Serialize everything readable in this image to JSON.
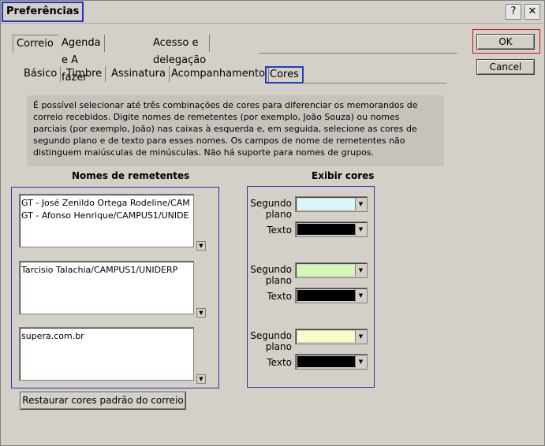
{
  "window": {
    "title": "Preferências",
    "help_label": "?",
    "close_label": "✕"
  },
  "tabs_top": [
    {
      "label": "Correio"
    },
    {
      "label": "Agenda e A fazer"
    },
    {
      "label": "Acesso e delegação"
    }
  ],
  "tabs_sub": [
    {
      "label": "Básico"
    },
    {
      "label": "Timbre"
    },
    {
      "label": "Assinatura"
    },
    {
      "label": "Acompanhamento"
    },
    {
      "label": "Cores"
    }
  ],
  "description": [
    "É possível selecionar até três combinações de cores para diferenciar os memorandos de",
    "correio recebidos.  Digite nomes de remetentes (por exemplo, João Souza) ou nomes",
    "parciais (por exemplo, João) nas caixas à esquerda e, em seguida, selecione as cores de",
    "segundo plano e de texto para esses nomes.  Os campos de nome de remetentes não",
    "distinguem maiúsculas de minúsculas.  Não há suporte para nomes de grupos."
  ],
  "senders": {
    "header": "Nomes de remetentes",
    "lists": [
      [
        "GT - José Zenildo Ortega Rodeline/CAM",
        "GT - Afonso Henrique/CAMPUS1/UNIDE"
      ],
      [
        "Tarcisio Talachia/CAMPUS1/UNIDERP"
      ],
      [
        "supera.com.br"
      ]
    ]
  },
  "colors": {
    "header": "Exibir cores",
    "bg_label_line1": "Segundo",
    "bg_label_line2": "plano",
    "text_label": "Texto",
    "combos": [
      {
        "background": "#d9f8fb",
        "text": "#000000"
      },
      {
        "background": "#d4f7b6",
        "text": "#000000"
      },
      {
        "background": "#fbfbc8",
        "text": "#000000"
      }
    ]
  },
  "buttons": {
    "ok": "OK",
    "cancel": "Cancel",
    "restore": "Restaurar cores padrão do correio"
  }
}
